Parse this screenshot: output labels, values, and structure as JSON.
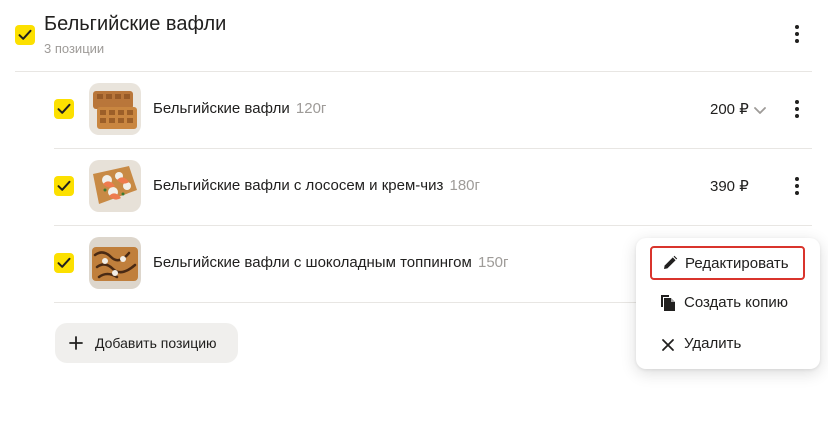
{
  "category": {
    "title": "Бельгийские вафли",
    "subtitle": "3 позиции",
    "checked": true
  },
  "items": [
    {
      "name": "Бельгийские вафли",
      "weight": "120г",
      "price": "200 ₽",
      "checked": true,
      "has_dropdown": true
    },
    {
      "name": "Бельгийские вафли с лососем и крем-чиз",
      "weight": "180г",
      "price": "390 ₽",
      "checked": true,
      "has_dropdown": false
    },
    {
      "name": "Бельгийские вафли с шоколадным топпингом",
      "weight": "150г",
      "price": "",
      "checked": true,
      "has_dropdown": false
    }
  ],
  "add_button": {
    "label": "Добавить позицию",
    "icon": "plus-icon"
  },
  "context_menu": {
    "items": [
      {
        "label": "Редактировать",
        "icon": "pencil-icon",
        "focused": true
      },
      {
        "label": "Создать копию",
        "icon": "copy-icon",
        "focused": false
      },
      {
        "label": "Удалить",
        "icon": "close-icon",
        "focused": false
      }
    ]
  },
  "colors": {
    "accent_yellow": "#fce000",
    "focus_red": "#d9342c",
    "muted_text": "#9e9b98"
  }
}
